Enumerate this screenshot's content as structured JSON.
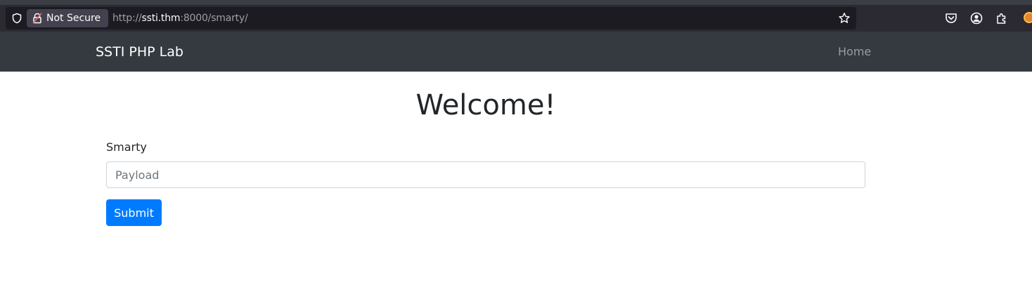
{
  "browser": {
    "security_label": "Not Secure",
    "url": {
      "scheme": "http://",
      "host": "ssti.thm",
      "rest": ":8000/smarty/"
    },
    "icons": [
      "shield-icon",
      "lock-icon",
      "star-icon",
      "pocket-icon",
      "account-icon",
      "extensions-icon",
      "extension-peek-icon"
    ]
  },
  "navbar": {
    "brand": "SSTI PHP Lab",
    "home_link": "Home",
    "background": "#343a40"
  },
  "main": {
    "title": "Welcome!",
    "form": {
      "label": "Smarty",
      "input_placeholder": "Payload",
      "input_value": "",
      "submit_label": "Submit",
      "submit_color": "#007bff"
    }
  }
}
